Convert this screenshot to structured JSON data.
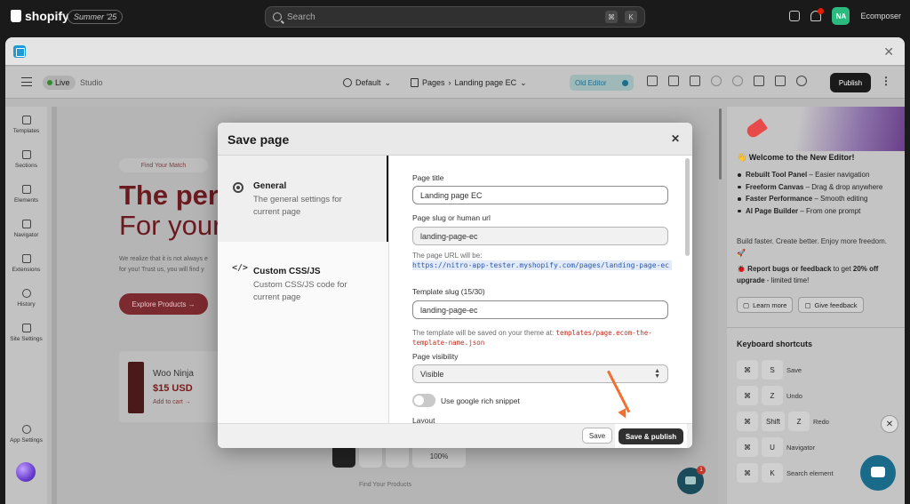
{
  "topbar": {
    "brand": "shopify",
    "badge": "Summer '25",
    "search_placeholder": "Search",
    "kbd_cmd": "⌘",
    "kbd_k": "K",
    "avatar_initials": "NA",
    "store_name": "Ecomposer"
  },
  "toolbar": {
    "live": "Live",
    "studio": "Studio",
    "theme": "Default",
    "pages": "Pages",
    "page_name": "Landing page EC",
    "old_editor": "Old Editor",
    "publish": "Publish"
  },
  "left_sidebar": {
    "items": [
      "Templates",
      "Sections",
      "Elements",
      "Navigator",
      "Extensions",
      "History",
      "Site Settings"
    ],
    "app_settings": "App Settings"
  },
  "canvas": {
    "find_pill": "Find Your Match",
    "hero_line1": "The per",
    "hero_line2": "For your",
    "hero_text1": "We realize that it is not always e",
    "hero_text2": "for you! Trust us, you will find y",
    "explore": "Explore Products →",
    "product_name": "Woo Ninja",
    "product_price": "$15 USD",
    "add_to_cart": "Add to cart →",
    "zoom": "100%",
    "footer": "Find Your Products"
  },
  "right_panel": {
    "welcome": "👋 Welcome to the New Editor!",
    "features": [
      {
        "bold": "Rebuilt Tool Panel",
        "text": " – Easier navigation"
      },
      {
        "bold": "Freeform Canvas",
        "text": " – Drag & drop anywhere"
      },
      {
        "bold": "Faster Performance",
        "text": " – Smooth editing"
      },
      {
        "bold": "AI Page Builder",
        "text": " – From one prompt"
      }
    ],
    "build_text": "Build faster. Create better. Enjoy more freedom. 🚀",
    "report_bold": "🐞 Report bugs or feedback",
    "report_mid": " to get ",
    "report_pct": "20% off upgrade",
    "report_end": " - limited time!",
    "learn_more": "Learn more",
    "give_feedback": "Give feedback",
    "kb_title": "Keyboard shortcuts",
    "shortcuts": [
      {
        "keys": [
          "⌘",
          "S"
        ],
        "label": "Save"
      },
      {
        "keys": [
          "⌘",
          "Z"
        ],
        "label": "Undo"
      },
      {
        "keys": [
          "⌘",
          "Shift",
          "Z"
        ],
        "label": "Redo"
      },
      {
        "keys": [
          "⌘",
          "U"
        ],
        "label": "Navigator"
      },
      {
        "keys": [
          "⌘",
          "K"
        ],
        "label": "Search element"
      }
    ],
    "chat_badge": "1"
  },
  "modal": {
    "title": "Save page",
    "nav": [
      {
        "title": "General",
        "desc": "The general settings for current page"
      },
      {
        "title": "Custom CSS/JS",
        "desc": "Custom CSS/JS code for current page"
      }
    ],
    "page_title_label": "Page title",
    "page_title_value": "Landing page EC",
    "slug_label": "Page slug or human url",
    "slug_value": "landing-page-ec",
    "url_hint": "The page URL will be:",
    "url_value": "https://nitro-app-tester.myshopify.com/pages/landing-page-ec",
    "template_slug_label": "Template slug (15/30)",
    "template_slug_value": "landing-page-ec",
    "template_hint": "The template will be saved on your theme at:",
    "template_path": "templates/page.ecom-the-template-name.json",
    "visibility_label": "Page visibility",
    "visibility_value": "Visible",
    "rich_snippet": "Use google rich snippet",
    "layout_label": "Layout",
    "save": "Save",
    "save_publish": "Save & publish"
  }
}
